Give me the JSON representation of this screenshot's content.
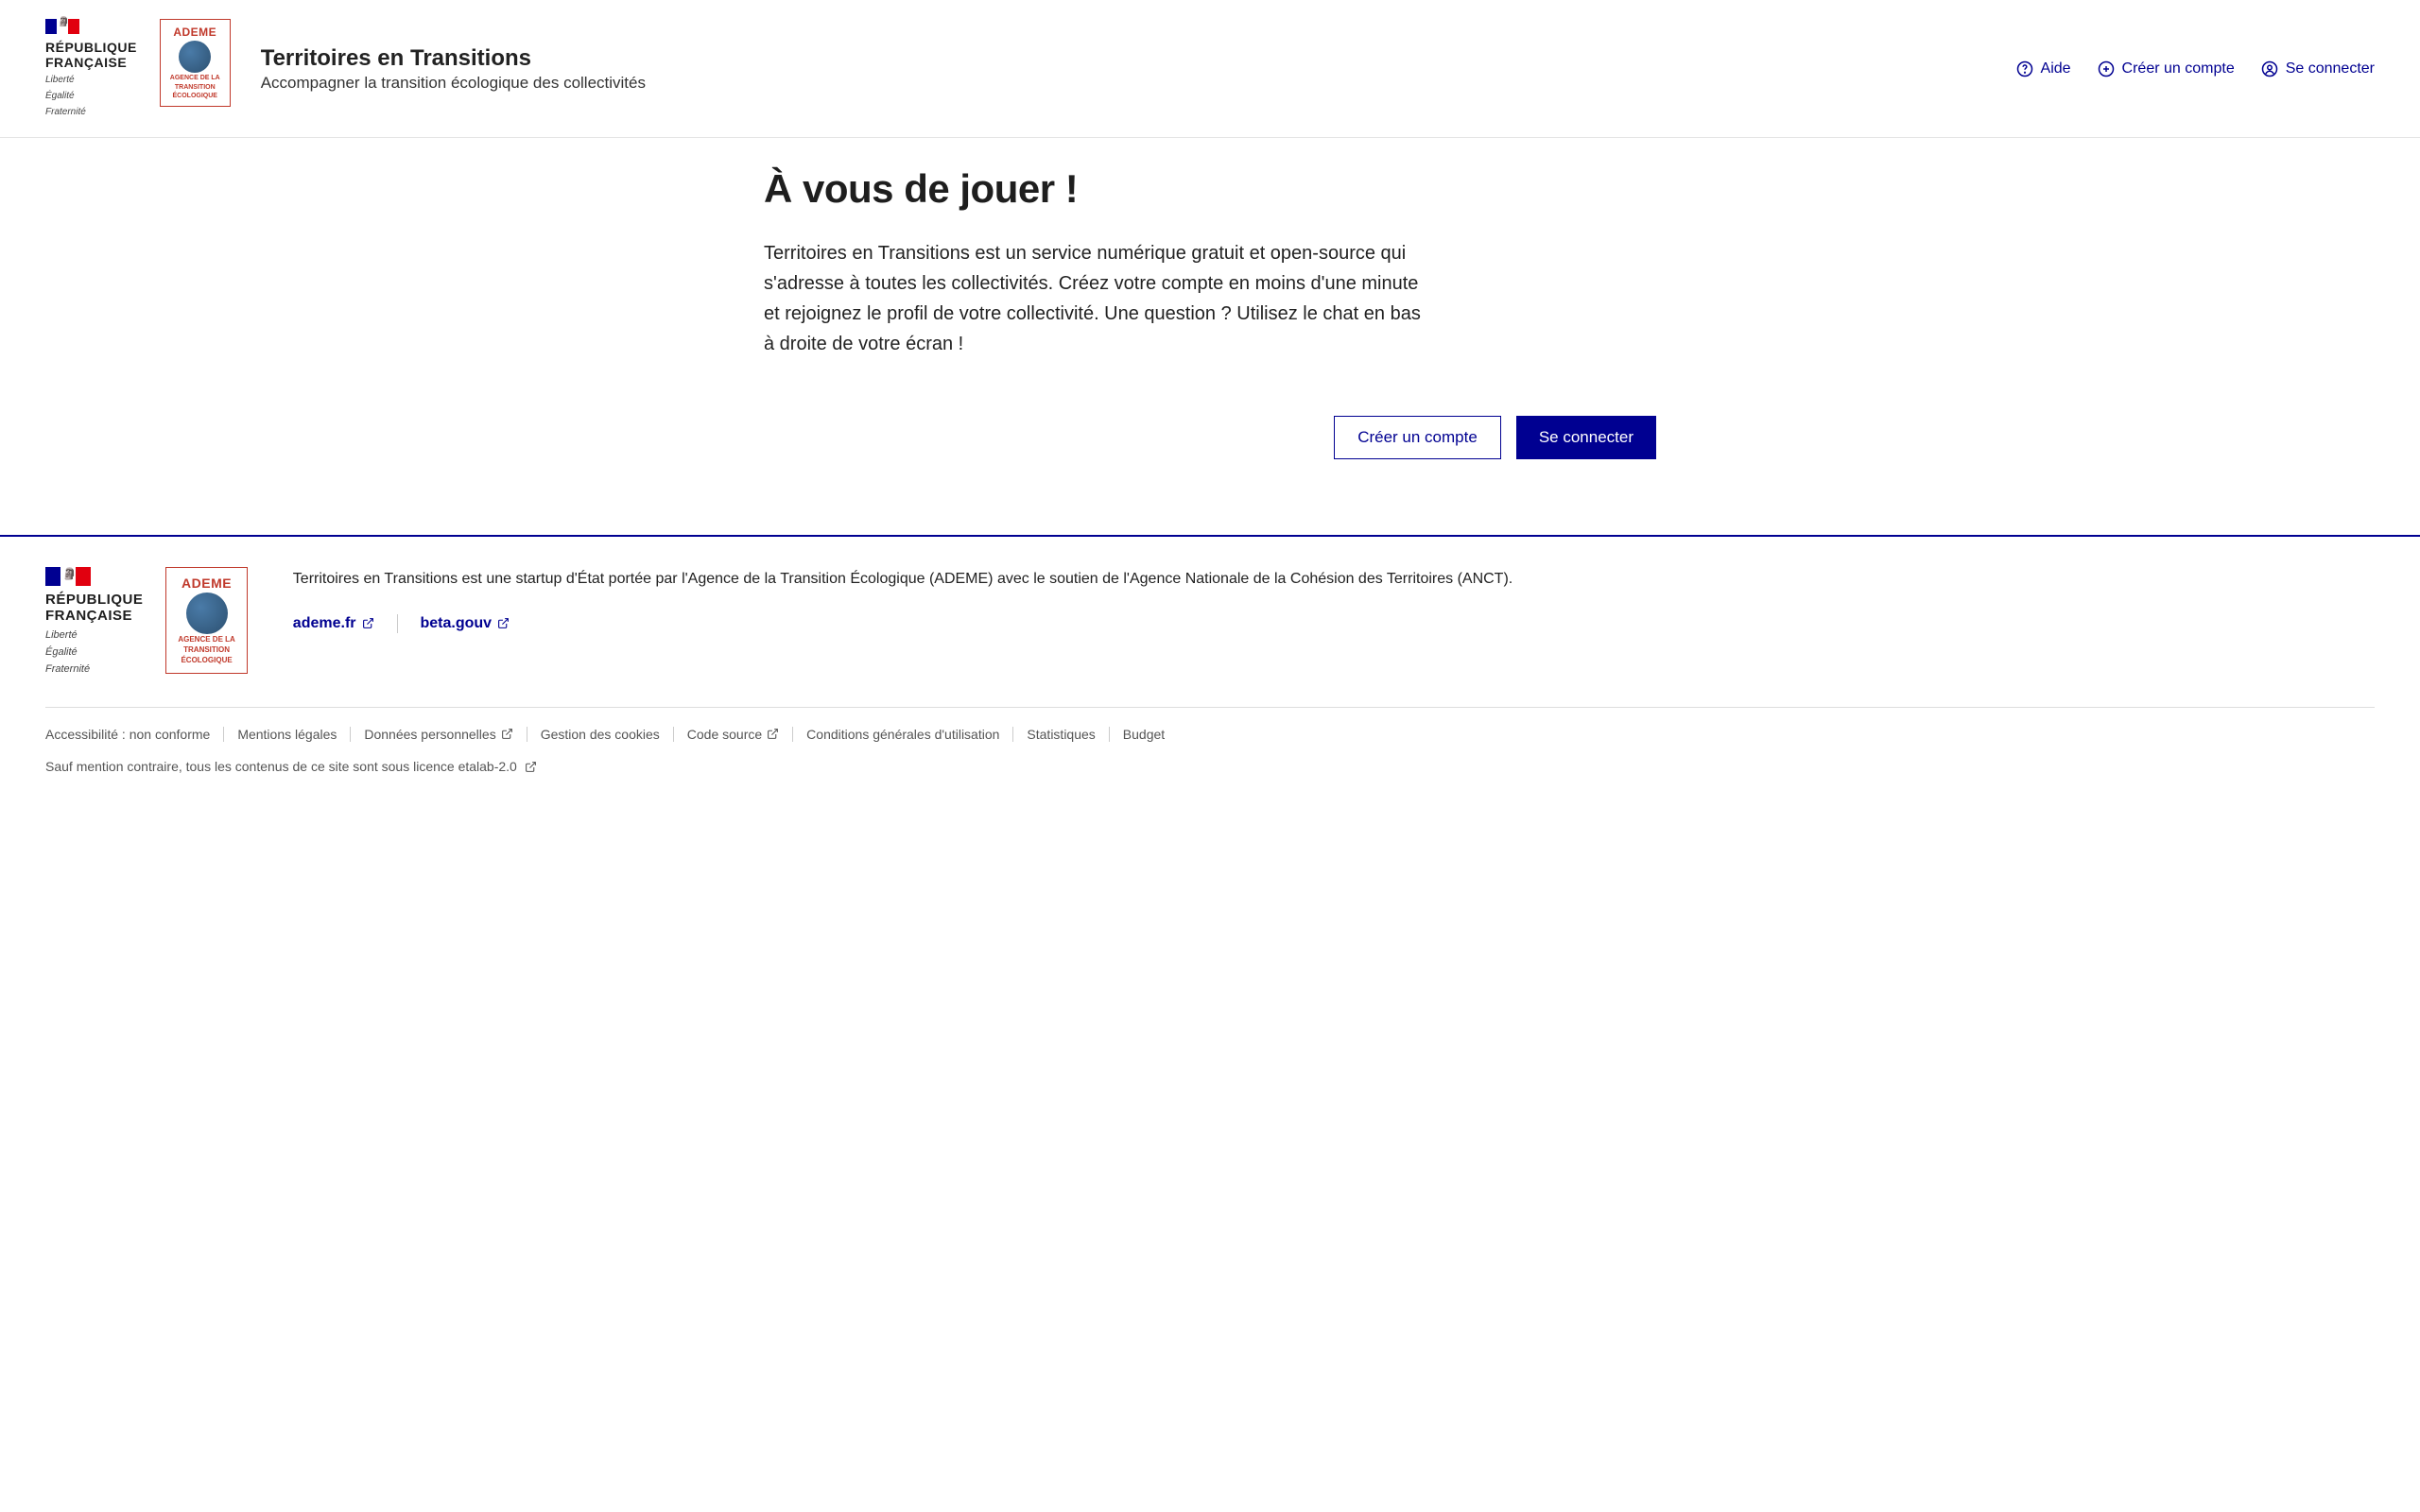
{
  "header": {
    "logo_rf_line1": "RÉPUBLIQUE",
    "logo_rf_line2": "FRANÇAISE",
    "logo_motto_line1": "Liberté",
    "logo_motto_line2": "Égalité",
    "logo_motto_line3": "Fraternité",
    "ademe_title": "ADEME",
    "ademe_sub_line1": "AGENCE DE LA",
    "ademe_sub_line2": "TRANSITION",
    "ademe_sub_line3": "ÉCOLOGIQUE",
    "site_title": "Territoires en Transitions",
    "site_tagline": "Accompagner la transition écologique des collectivités",
    "nav_help": "Aide",
    "nav_create": "Créer un compte",
    "nav_login": "Se connecter"
  },
  "main": {
    "title": "À vous de jouer !",
    "text": "Territoires en Transitions est un service numérique gratuit et open-source qui s'adresse à toutes les collectivités. Créez votre compte en moins d'une minute et rejoignez le profil de votre collectivité. Une question ? Utilisez le chat en bas à droite de votre écran !",
    "cta_create": "Créer un compte",
    "cta_login": "Se connecter"
  },
  "footer": {
    "desc": "Territoires en Transitions est une startup d'État portée par l'Agence de la Transition Écologique (ADEME) avec le soutien de l'Agence Nationale de la Cohésion des Territoires (ANCT).",
    "ext_ademe": "ademe.fr",
    "ext_beta": "beta.gouv",
    "links": {
      "accessibility": "Accessibilité : non conforme",
      "legal": "Mentions légales",
      "data": "Données personnelles",
      "cookies": "Gestion des cookies",
      "source": "Code source",
      "cgu": "Conditions générales d'utilisation",
      "stats": "Statistiques",
      "budget": "Budget"
    },
    "license_prefix": "Sauf mention contraire, tous les contenus de ce site sont sous ",
    "license_link": "licence etalab-2.0"
  },
  "colors": {
    "fr_blue": "#000091",
    "fr_red": "#e1000f"
  }
}
